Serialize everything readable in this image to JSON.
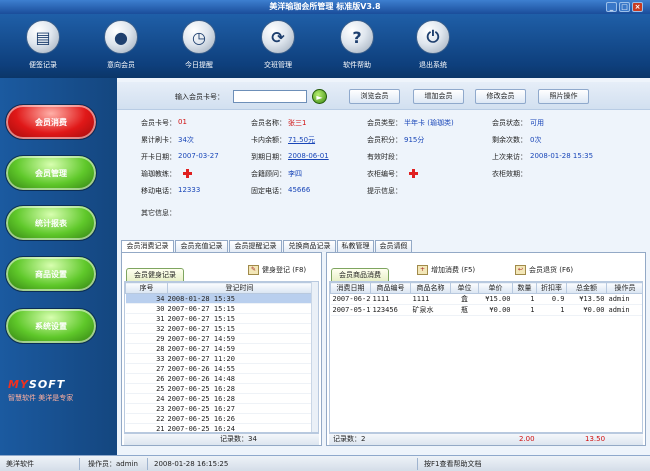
{
  "window": {
    "title": "美洋瑜珈会所管理 标准版V3.8",
    "min": "_",
    "max": "□",
    "close": "×"
  },
  "toolbar": [
    {
      "label": "便签记录",
      "icon": "clipboard-icon",
      "glyph": "▤"
    },
    {
      "label": "意向会员",
      "icon": "person-icon",
      "glyph": "●"
    },
    {
      "label": "今日提醒",
      "icon": "clock-icon",
      "glyph": "◷"
    },
    {
      "label": "交班管理",
      "icon": "refresh-icon",
      "glyph": "⟳"
    },
    {
      "label": "软件帮助",
      "icon": "help-icon",
      "glyph": "?"
    },
    {
      "label": "退出系统",
      "icon": "power-icon",
      "glyph": "⏻"
    }
  ],
  "nav": [
    "会员消费",
    "会员管理",
    "统计报表",
    "商品设置",
    "系统设置"
  ],
  "logo": {
    "brand_a": "MY",
    "brand_b": "SOFT",
    "slogan": "智慧软件 美洋是专家"
  },
  "search": {
    "label": "输入会员卡号：",
    "value": "",
    "go": "►",
    "buttons": [
      "浏览会员",
      "增加会员",
      "修改会员",
      "照片操作"
    ]
  },
  "member": {
    "card_no_label": "会员卡号：",
    "card_no": "01",
    "name_label": "会员名称：",
    "name": "张三1",
    "type_label": "会员类型：",
    "type": "半年卡 (瑜珈类)",
    "status_label": "会员状态：",
    "status": "可用",
    "swipes_label": "累计刷卡：",
    "swipes": "34次",
    "balance_label": "卡内余额：",
    "balance": "71.50元",
    "points_label": "会员积分：",
    "points": "915分",
    "remaining_label": "剩余次数：",
    "remaining": "0次",
    "open_date_label": "开卡日期：",
    "open_date": "2007-03-27",
    "expire_label": "到期日期：",
    "expire": "2008-06-01",
    "valid_label": "有效时段：",
    "valid": "",
    "last_visit_label": "上次来访：",
    "last_visit": "2008-01-28 15:35",
    "coach_label": "瑜珈教练：",
    "consultant_label": "会籍顾问：",
    "consultant": "李四",
    "locker_label": "衣柜编号：",
    "locker_expire_label": "衣柜效期：",
    "mobile_label": "移动电话：",
    "mobile": "12333",
    "phone_label": "固定电话：",
    "phone": "45666",
    "hint_label": "提示信息：",
    "other_label": "其它信息："
  },
  "tabs": [
    "会员消费记录",
    "会员充值记录",
    "会员提醒记录",
    "兑换商品记录",
    "私教管理",
    "会员请假"
  ],
  "gym": {
    "subtab": "会员健身记录",
    "action": "健身登记 (F8)",
    "columns": [
      "序号",
      "登记时间"
    ],
    "rows": [
      [
        "34",
        "2008-01-28 15:35"
      ],
      [
        "30",
        "2007-06-27 15:15"
      ],
      [
        "31",
        "2007-06-27 15:15"
      ],
      [
        "32",
        "2007-06-27 15:15"
      ],
      [
        "29",
        "2007-06-27 14:59"
      ],
      [
        "28",
        "2007-06-27 14:59"
      ],
      [
        "33",
        "2007-06-27 11:20"
      ],
      [
        "27",
        "2007-06-26 14:55"
      ],
      [
        "26",
        "2007-06-26 14:48"
      ],
      [
        "25",
        "2007-06-25 16:28"
      ],
      [
        "24",
        "2007-06-25 16:28"
      ],
      [
        "23",
        "2007-06-25 16:27"
      ],
      [
        "22",
        "2007-06-25 16:26"
      ],
      [
        "21",
        "2007-06-25 16:24"
      ]
    ],
    "footer": "记录数：34"
  },
  "goods": {
    "subtab": "会员商品消费",
    "add": "增加消费 (F5)",
    "refund": "会员退货 (F6)",
    "columns": [
      "消费日期",
      "商品编号",
      "商品名称",
      "单位",
      "单价",
      "数量",
      "折扣率",
      "总金额",
      "操作员"
    ],
    "rows": [
      [
        "2007-06-27",
        "1111",
        "1111",
        "盒",
        "¥15.00",
        "1",
        "0.9",
        "¥13.50",
        "admin"
      ],
      [
        "2007-05-17",
        "123456",
        "矿泉水",
        "瓶",
        "¥0.00",
        "1",
        "1",
        "¥0.00",
        "admin"
      ]
    ],
    "footer_count": "记录数：2",
    "footer_qty": "2.00",
    "footer_total": "13.50"
  },
  "status": {
    "company": "美洋软件",
    "operator_label": "操作员：",
    "operator": "admin",
    "time": "2008-01-28 16:15:25",
    "hint": "按F1查看帮助文档"
  },
  "colors": {
    "accent": "#1a4f8a",
    "nav_active": "#e01818",
    "nav": "#5fc82a",
    "value": "#1946b8",
    "total": "#d01010"
  }
}
